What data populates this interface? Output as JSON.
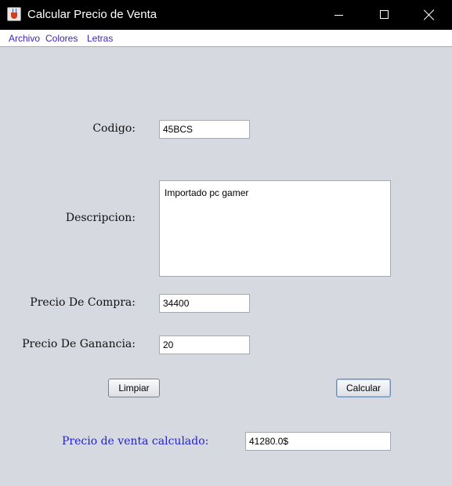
{
  "window": {
    "title": "Calcular Precio de Venta",
    "icon": "java-cup-icon"
  },
  "menubar": {
    "items": [
      "Archivo",
      "Colores",
      "Letras"
    ],
    "color": "#3d1fbf"
  },
  "form": {
    "codigo_label": "Codigo:",
    "codigo_value": "45BCS",
    "descripcion_label": "Descripcion:",
    "descripcion_value": "Importado pc gamer",
    "precio_compra_label": "Precio De Compra:",
    "precio_compra_value": "34400",
    "precio_ganancia_label": "Precio De Ganancia:",
    "precio_ganancia_value": "20"
  },
  "buttons": {
    "limpiar": "Limpiar",
    "calcular": "Calcular"
  },
  "result": {
    "label": "Precio de venta calculado:",
    "value": "41280.0$",
    "label_color": "#2222cc"
  },
  "colors": {
    "background": "#d6d9e0",
    "titlebar": "#000000"
  }
}
